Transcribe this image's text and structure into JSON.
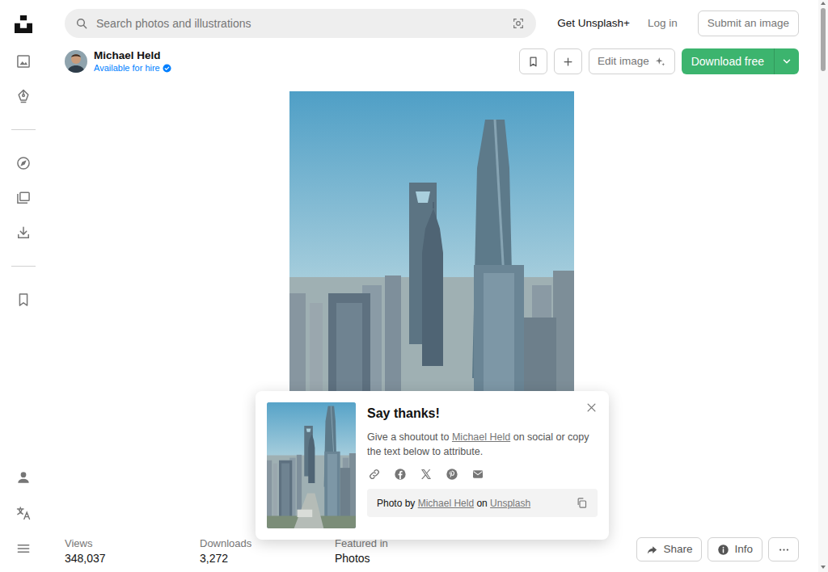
{
  "search": {
    "placeholder": "Search photos and illustrations"
  },
  "nav": {
    "plus": "Get Unsplash+",
    "login": "Log in",
    "submit": "Submit an image"
  },
  "author": {
    "name": "Michael Held",
    "status": "Available for hire"
  },
  "actions": {
    "edit": "Edit image",
    "download": "Download free"
  },
  "stats": [
    {
      "label": "Views",
      "value": "348,037"
    },
    {
      "label": "Downloads",
      "value": "3,272"
    },
    {
      "label": "Featured in",
      "value": "Photos"
    }
  ],
  "footer_buttons": [
    "Share",
    "Info"
  ],
  "thanks_popup": {
    "title": "Say thanks!",
    "text_before": "Give a shoutout to ",
    "author_link": "Michael Held",
    "text_after": " on social or copy the text below to attribute.",
    "attribution": {
      "prefix": "Photo by ",
      "author": "Michael Held",
      "middle": " on ",
      "site": "Unsplash"
    }
  }
}
